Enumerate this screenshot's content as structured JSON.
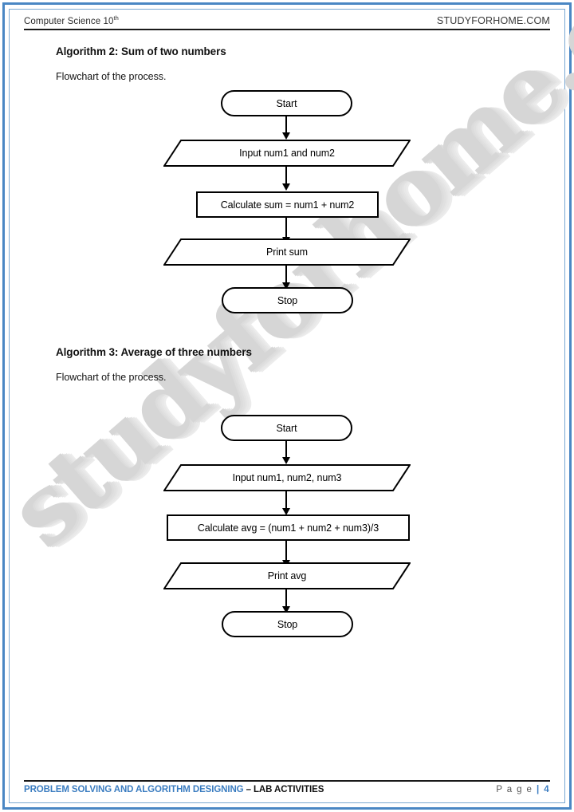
{
  "page": {
    "border_color": "#4a87c4",
    "watermark_text": "studyforhome.com",
    "watermark_color": "#d6d6d6"
  },
  "header": {
    "left_text": "Computer Science 10",
    "left_superscript": "th",
    "right_text": "STUDYFORHOME.COM"
  },
  "sections": [
    {
      "heading": "Algorithm 2: Sum of two numbers",
      "subheading": "Flowchart of the process.",
      "flowchart": {
        "nodes": [
          {
            "shape": "terminal",
            "label": "Start"
          },
          {
            "shape": "io",
            "label": "Input num1 and num2"
          },
          {
            "shape": "process",
            "label": "Calculate sum = num1 + num2"
          },
          {
            "shape": "io",
            "label": "Print sum"
          },
          {
            "shape": "terminal",
            "label": "Stop"
          }
        ]
      }
    },
    {
      "heading": "Algorithm 3: Average of three numbers",
      "subheading": "Flowchart of the process.",
      "flowchart": {
        "nodes": [
          {
            "shape": "terminal",
            "label": "Start"
          },
          {
            "shape": "io",
            "label": "Input num1, num2, num3"
          },
          {
            "shape": "process",
            "label": "Calculate avg = (num1 + num2 + num3)/3"
          },
          {
            "shape": "io",
            "label": "Print avg"
          },
          {
            "shape": "terminal",
            "label": "Stop"
          }
        ]
      }
    }
  ],
  "footer": {
    "title_highlight": "PROBLEM SOLVING AND ALGORITHM DESIGNING",
    "title_rest": " – LAB ACTIVITIES",
    "page_label": "P a g e",
    "page_separator": "|",
    "page_number": "4",
    "accent_color": "#3a7cc0"
  }
}
